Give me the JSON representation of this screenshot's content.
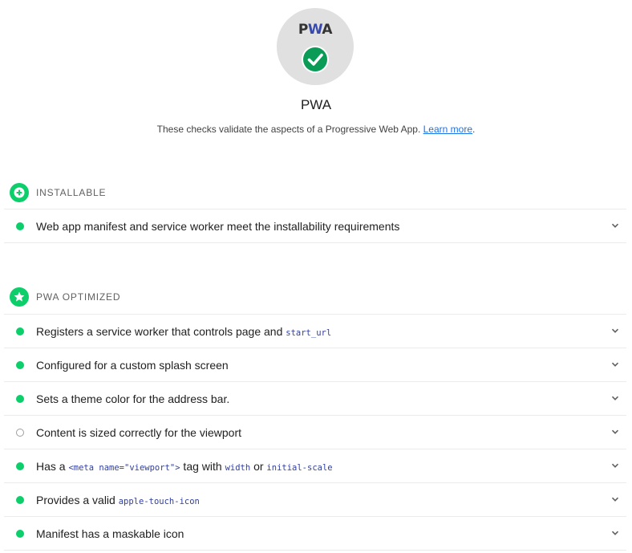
{
  "header": {
    "logo_prefix": "P",
    "logo_w": "W",
    "logo_suffix": "A",
    "title": "PWA",
    "description_prefix": "These checks validate the aspects of a Progressive Web App. ",
    "learn_more": "Learn more",
    "description_suffix": "."
  },
  "groups": [
    {
      "title": "INSTALLABLE",
      "icon": "plus-circle-icon",
      "audits": [
        {
          "status": "pass",
          "parts": [
            "Web app manifest and service worker meet the installability requirements"
          ]
        }
      ]
    },
    {
      "title": "PWA OPTIMIZED",
      "icon": "star-circle-icon",
      "audits": [
        {
          "status": "pass",
          "parts": [
            "Registers a service worker that controls page and ",
            "start_url"
          ]
        },
        {
          "status": "pass",
          "parts": [
            "Configured for a custom splash screen"
          ]
        },
        {
          "status": "pass",
          "parts": [
            "Sets a theme color for the address bar."
          ]
        },
        {
          "status": "na",
          "parts": [
            "Content is sized correctly for the viewport"
          ]
        },
        {
          "status": "pass",
          "parts": [
            "Has a ",
            "<meta name=\"viewport\">",
            " tag with ",
            "width",
            " or ",
            "initial-scale"
          ]
        },
        {
          "status": "pass",
          "parts": [
            "Provides a valid ",
            "apple-touch-icon"
          ]
        },
        {
          "status": "pass",
          "parts": [
            "Manifest has a maskable icon"
          ]
        }
      ]
    }
  ],
  "colors": {
    "pass": "#0cce6b",
    "code": "#303f9f",
    "link": "#1a73e8"
  }
}
